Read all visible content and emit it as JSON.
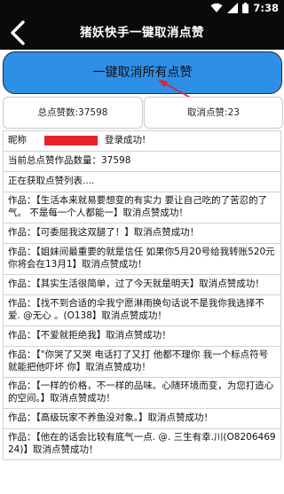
{
  "status_bar": {
    "time": "7:38",
    "icons": [
      "wifi-icon",
      "signal-icon",
      "battery-icon"
    ]
  },
  "header": {
    "title": "猪妖快手一键取消点赞",
    "back_icon": "back-chevron-icon"
  },
  "main_button": {
    "label": "一键取消所有点赞"
  },
  "stats": {
    "total_likes": "总点赞数:37598",
    "cancelled_likes": "取消点赞:23"
  },
  "log": {
    "nickname_prefix": "昵称",
    "nickname_suffix": "登录成功!",
    "lines": [
      "当前总点赞作品数量：37598",
      "正在获取点赞列表....",
      "作品：【生活本来就易要想变的有实力 要让自己吃的了苦忍的了气。 不是每一个人都能一】取消点赞成功！",
      "作品：【可委屈我这双腿了！】取消点赞成功！",
      "作品：【姐妹间最重要的就是信任 如果你5月20号给我转账520元 你将会在13月1】取消点赞成功！",
      "作品：【其实生活很简单，过了今天就是明天】取消点赞成功！",
      "作品：【找不到合适的伞我宁愿淋雨换句话说不是我你我选择不爱. @无心 。(O138】取消点赞成功！",
      "作品：【不爱就拒绝我】取消点赞成功！",
      "作品：【\"你哭了又哭 电话打了又打 他都不理你 我一个标点符号就能把他吓坏 你】取消点赞成功！",
      "作品：【一样的价格，不一样的品味。心随环境而变，为您打造心的空间。】取消点赞成功！",
      "作品：【高级玩家不养鱼没对象。】取消点赞成功！",
      "作品：【他在的话会比较有底气一点. @. 三生有幸.川(O820646924)】取消点赞成功！"
    ]
  },
  "colors": {
    "bar_background": "#0a0a0a",
    "main_button": "#2e8fe6",
    "arrow": "#d9263a",
    "redaction": "#e8222a"
  }
}
